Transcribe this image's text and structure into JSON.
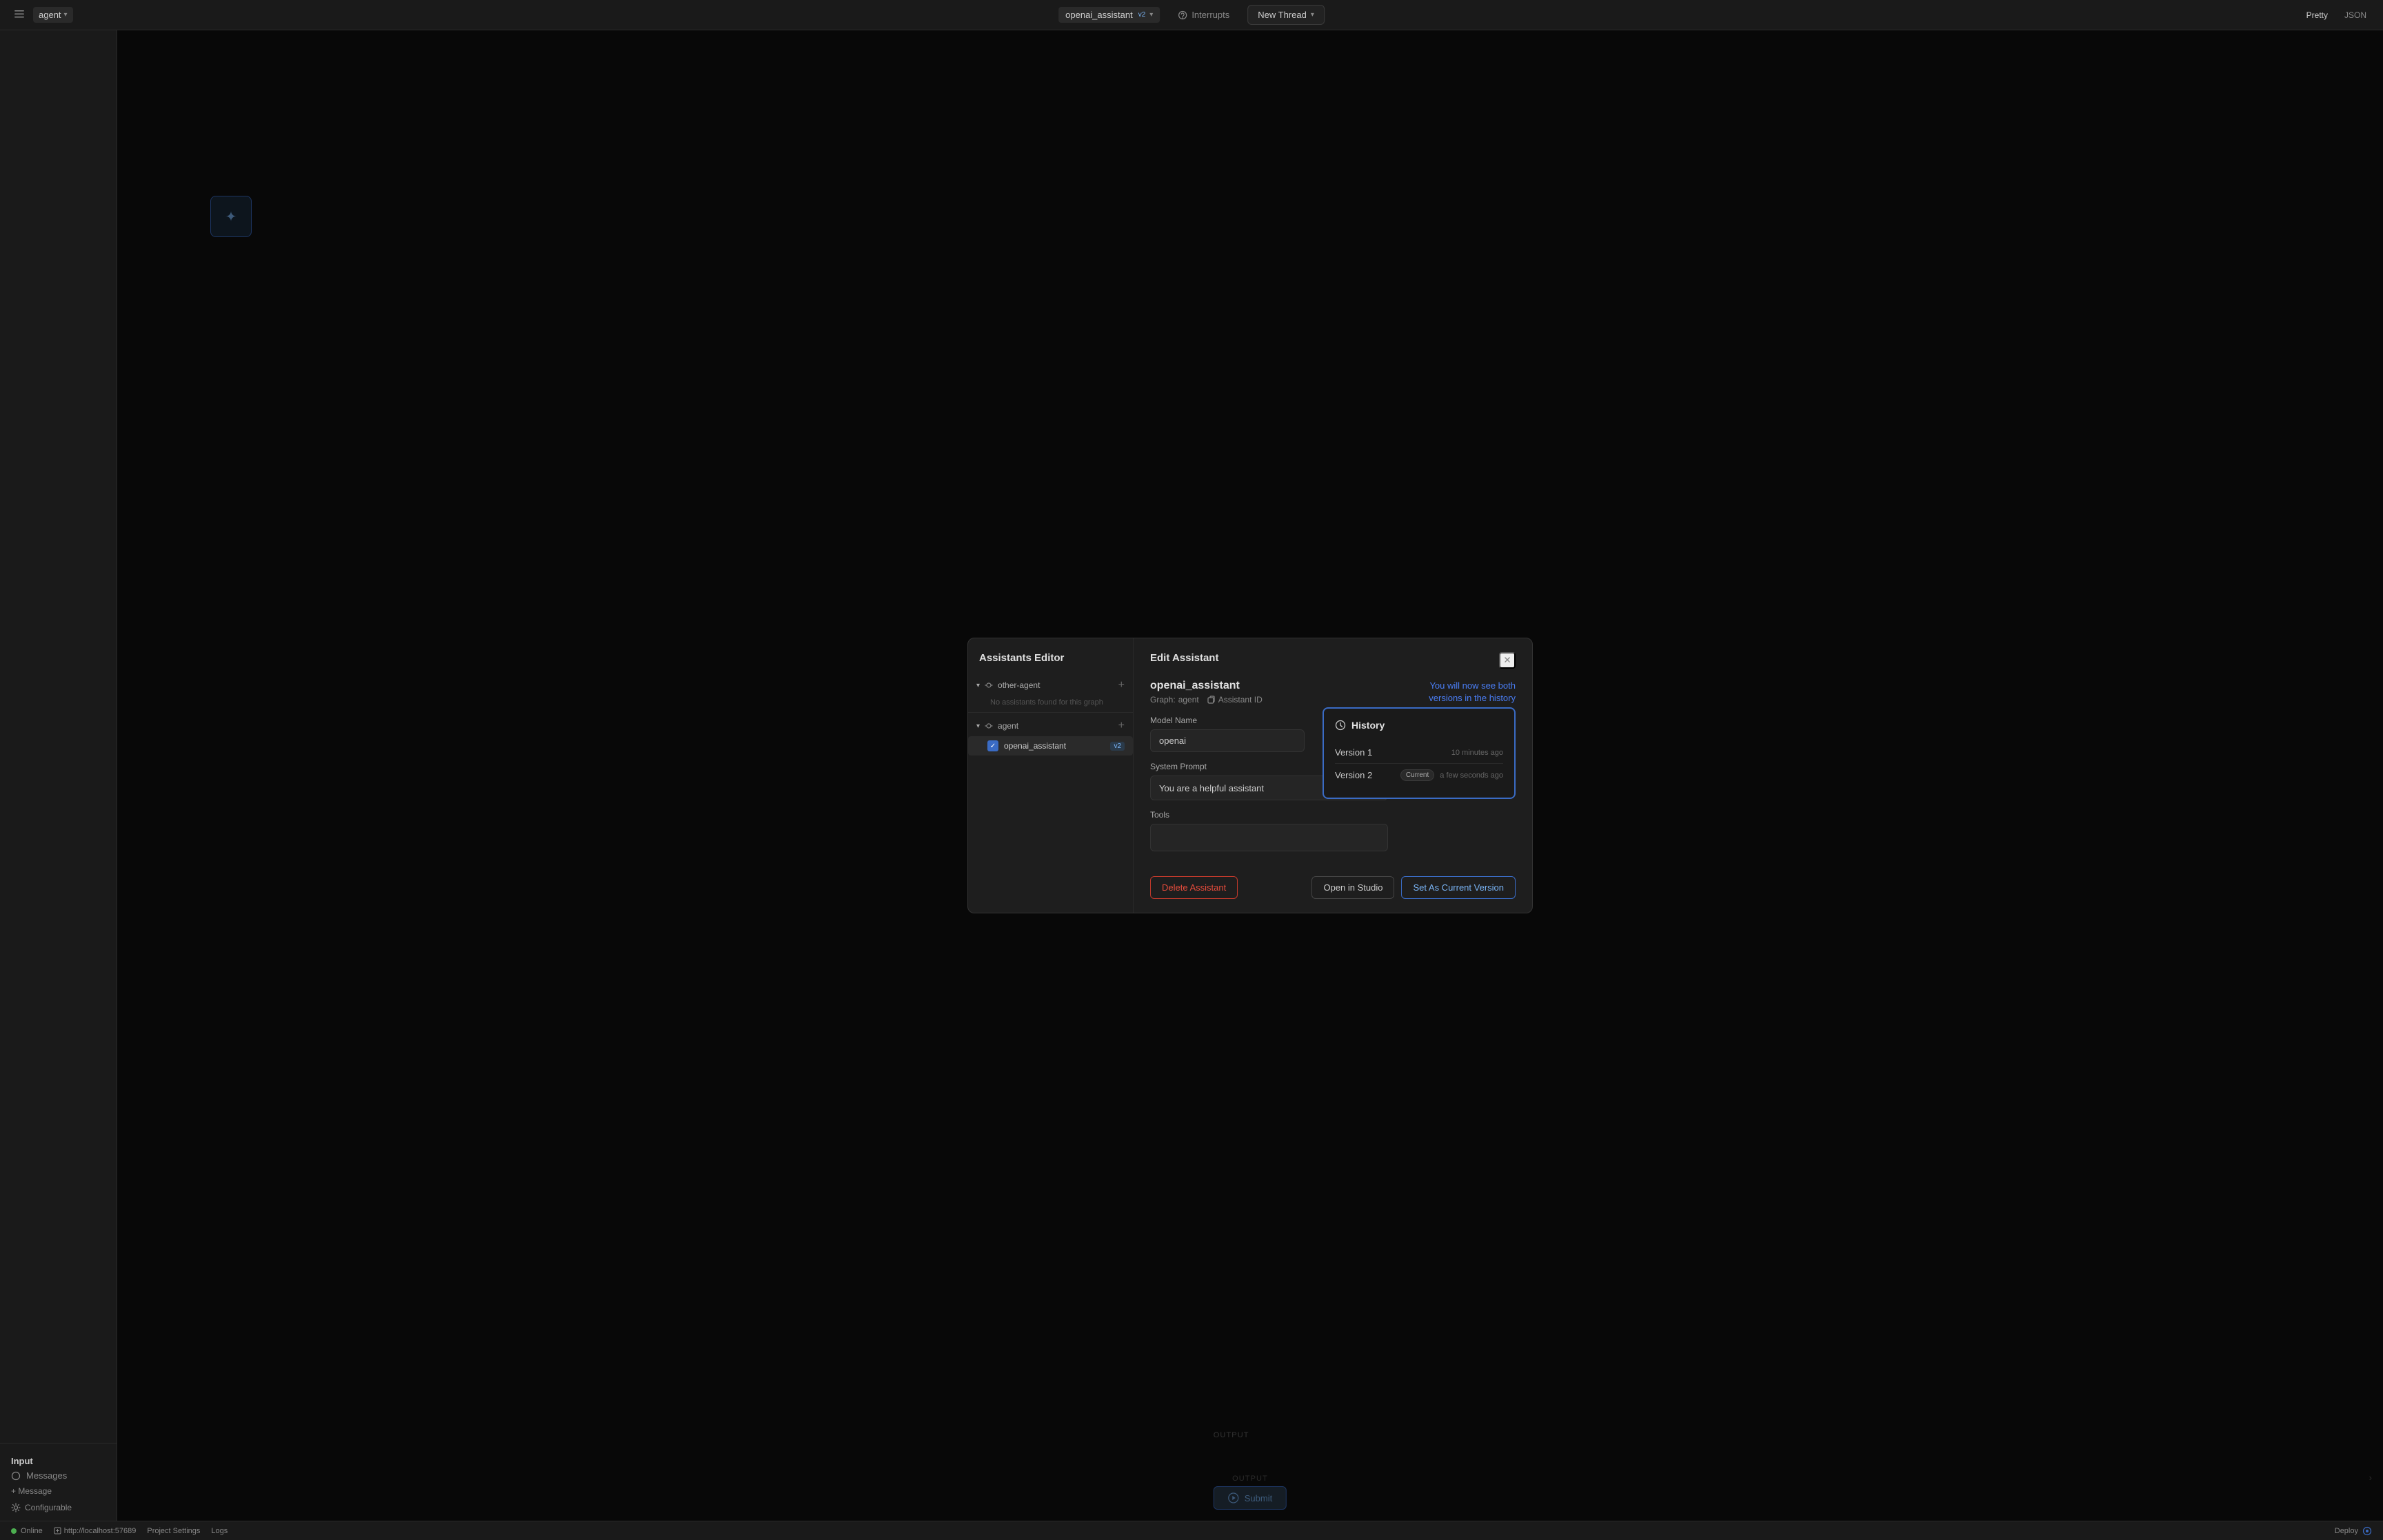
{
  "topbar": {
    "sidebar_toggle_label": "☰",
    "agent_label": "agent",
    "caret": "▾",
    "assistant_label": "openai_assistant",
    "assistant_version": "v2",
    "interrupts_label": "Interrupts",
    "new_thread_label": "New Thread",
    "pretty_label": "Pretty",
    "json_label": "JSON"
  },
  "modal": {
    "left_title": "Assistants Editor",
    "right_title": "Edit Assistant",
    "close_label": "✕",
    "other_agent_label": "other-agent",
    "other_agent_empty": "No assistants found for this graph",
    "agent_label": "agent",
    "assistant_name": "openai_assistant",
    "assistant_version_badge": "v2",
    "assistant_full_name": "openai_assistant",
    "graph_label": "Graph:",
    "graph_value": "agent",
    "assistant_id_label": "Assistant ID",
    "model_name_label": "Model Name",
    "model_name_value": "openai",
    "system_prompt_label": "System Prompt",
    "system_prompt_value": "You are a helpful assistant",
    "tools_label": "Tools",
    "history_tooltip_line1": "You will now see both",
    "history_tooltip_line2": "versions in the history",
    "history_title": "History",
    "version1_label": "Version 1",
    "version1_time": "10 minutes ago",
    "version2_label": "Version 2",
    "version2_badge": "Current",
    "version2_time": "a few seconds ago",
    "delete_btn_label": "Delete Assistant",
    "open_studio_label": "Open in Studio",
    "set_current_label": "Set As Current Version"
  },
  "input_panel": {
    "title": "Input",
    "messages_label": "Messages",
    "add_message_label": "+ Message",
    "configurable_label": "Configurable"
  },
  "submit": {
    "label": "Submit"
  },
  "output": {
    "label": "OUTPUT"
  },
  "status_bar": {
    "online_label": "Online",
    "url": "http://localhost:57689",
    "project_settings": "Project Settings",
    "logs": "Logs",
    "deploy_label": "Deploy"
  }
}
